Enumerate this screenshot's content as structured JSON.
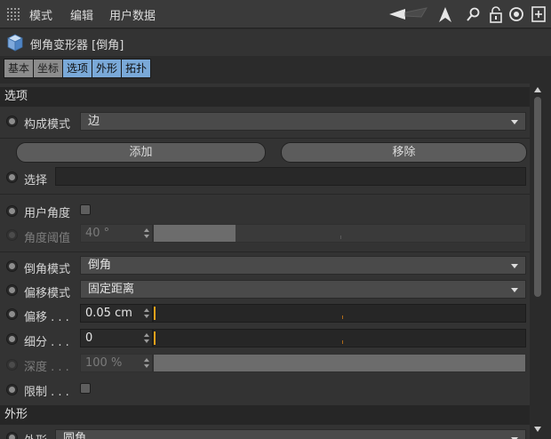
{
  "menu": {
    "items": [
      "模式",
      "编辑",
      "用户数据"
    ]
  },
  "icons": {
    "toolbar": [
      "back-arrow-icon",
      "cursor-arrow-icon",
      "search-icon",
      "lock-icon",
      "target-icon",
      "new-panel-icon"
    ]
  },
  "object": {
    "title": "倒角变形器 [倒角]"
  },
  "tabs": [
    {
      "label": "基本",
      "active": false
    },
    {
      "label": "坐标",
      "active": false
    },
    {
      "label": "选项",
      "active": true
    },
    {
      "label": "外形",
      "active": true
    },
    {
      "label": "拓扑",
      "active": true
    }
  ],
  "options": {
    "section_title": "选项",
    "construction_mode_label": "构成模式",
    "construction_mode_value": "边",
    "add_button": "添加",
    "remove_button": "移除",
    "selection_label": "选择",
    "selection_value": "",
    "use_angle_label": "用户角度",
    "use_angle_checked": false,
    "angle_threshold_label": "角度阈值",
    "angle_threshold_value": "40 °",
    "angle_threshold_fraction": 0.22,
    "bevel_mode_label": "倒角模式",
    "bevel_mode_value": "倒角",
    "offset_mode_label": "偏移模式",
    "offset_mode_value": "固定距离",
    "offset_label": "偏移 . . .",
    "offset_value": "0.05 cm",
    "subdivision_label": "细分 . . .",
    "subdivision_value": "0",
    "depth_label": "深度 . . .",
    "depth_value": "100 %",
    "depth_fraction": 1.0,
    "limit_label": "限制 . . .",
    "limit_checked": false
  },
  "shape": {
    "section_title": "外形",
    "partial_row_label": "外形",
    "partial_row_value": "圆角"
  },
  "colors": {
    "accent_tab": "#7aa9d8",
    "slider_knob": "#f0a21a"
  }
}
